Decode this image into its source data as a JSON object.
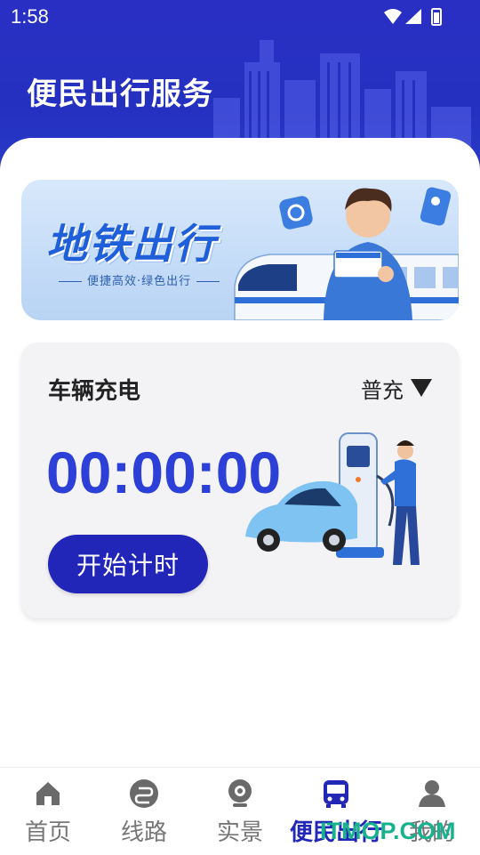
{
  "status_bar": {
    "time": "1:58"
  },
  "header": {
    "title": "便民出行服务"
  },
  "banner": {
    "title": "地铁出行",
    "subtitle": "便捷高效·绿色出行"
  },
  "charge_card": {
    "title": "车辆充电",
    "mode": "普充",
    "timer": "00:00:00",
    "start_label": "开始计时"
  },
  "bottom_nav": {
    "items": [
      {
        "label": "首页",
        "icon": "home-icon"
      },
      {
        "label": "线路",
        "icon": "route-icon"
      },
      {
        "label": "实景",
        "icon": "camera-icon"
      },
      {
        "label": "便民出行",
        "icon": "bus-icon",
        "active": true
      },
      {
        "label": "我的",
        "icon": "user-icon"
      }
    ]
  },
  "watermark": "ITMOP.COM",
  "colors": {
    "brand": "#2327b6",
    "timer": "#2c3fd6",
    "header": "#2a2fc4",
    "watermark": "#16b28e"
  }
}
